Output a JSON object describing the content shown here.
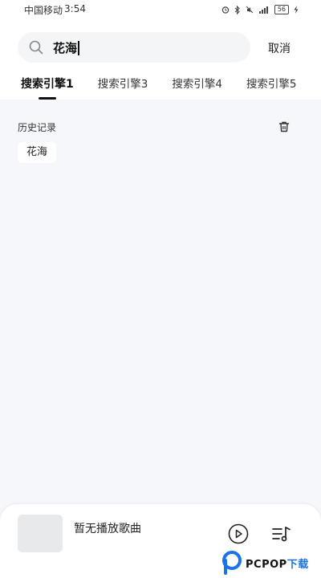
{
  "status_bar": {
    "carrier": "中国移动",
    "time": "3:54",
    "battery": "56"
  },
  "search": {
    "value": "花海",
    "cancel_label": "取消"
  },
  "tabs": [
    {
      "label": "搜索引擎1",
      "active": true
    },
    {
      "label": "搜索引擎3",
      "active": false
    },
    {
      "label": "搜索引擎4",
      "active": false
    },
    {
      "label": "搜索引擎5",
      "active": false
    }
  ],
  "history": {
    "title": "历史记录",
    "items": [
      "花海"
    ]
  },
  "player": {
    "song_title": "暂无播放歌曲"
  },
  "watermark": {
    "brand_main": "PCPOP",
    "brand_suffix": "下载"
  },
  "colors": {
    "background": "#ffffff",
    "content_background": "#f5f7fa",
    "search_background": "#f4f5f7",
    "text_primary": "#111111",
    "watermark_accent": "#1a73e8"
  }
}
